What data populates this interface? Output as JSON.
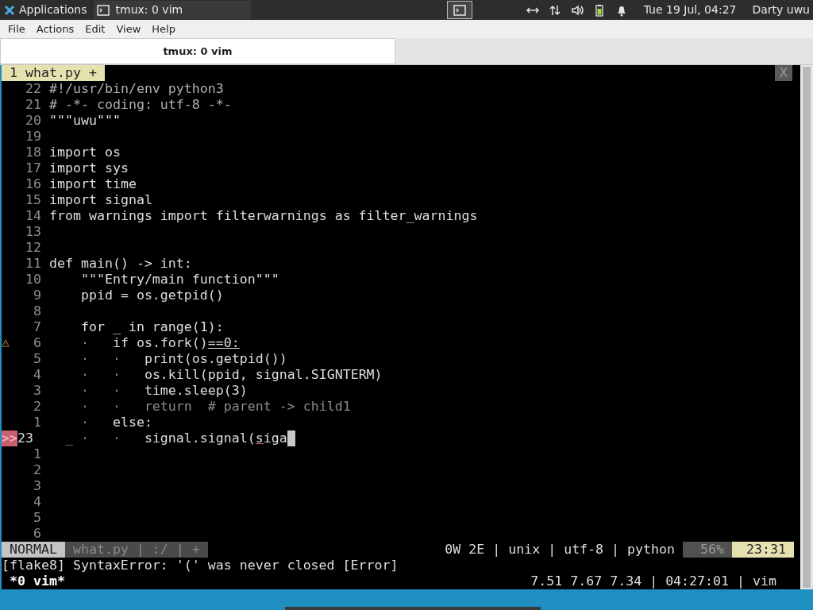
{
  "top_panel": {
    "applications": "Applications",
    "task": "tmux: 0 vim",
    "clock": "Tue 19 Jul, 04:27",
    "user": "Darty uwu"
  },
  "menu": [
    "File",
    "Actions",
    "Edit",
    "View",
    "Help"
  ],
  "window_tabs": [
    {
      "label": "tmux: 0 vim",
      "selected": true
    }
  ],
  "vim_tabs": [
    {
      "label": "1 what.py +",
      "selected": true
    }
  ],
  "vim_close": "X",
  "lines": [
    {
      "number": "22",
      "segments": [
        {
          "text": "#!/usr/bin/env python3",
          "kind": "comment"
        }
      ]
    },
    {
      "number": "21",
      "segments": [
        {
          "text": "# -*- coding: utf-8 -*-",
          "kind": "comment"
        }
      ]
    },
    {
      "number": "20",
      "segments": [
        {
          "text": "\"\"\"uwu\"\"\"",
          "kind": "plain"
        }
      ]
    },
    {
      "number": "19"
    },
    {
      "number": "18",
      "segments": [
        {
          "text": "import os",
          "kind": "plain"
        }
      ]
    },
    {
      "number": "17",
      "segments": [
        {
          "text": "import sys",
          "kind": "plain"
        }
      ]
    },
    {
      "number": "16",
      "segments": [
        {
          "text": "import time",
          "kind": "plain"
        }
      ]
    },
    {
      "number": "15",
      "segments": [
        {
          "text": "import signal",
          "kind": "plain"
        }
      ]
    },
    {
      "number": "14",
      "segments": [
        {
          "text": "from warnings import filterwarnings as filter_warnings",
          "kind": "plain"
        }
      ]
    },
    {
      "number": "13"
    },
    {
      "number": "12"
    },
    {
      "number": "11",
      "segments": [
        {
          "text": "def main() -> int:",
          "kind": "plain"
        }
      ]
    },
    {
      "number": "10",
      "segments": [
        {
          "text": "    \"\"\"Entry/main function\"\"\"",
          "kind": "plain"
        }
      ]
    },
    {
      "number": "9",
      "segments": [
        {
          "text": "    ppid = os.getpid()",
          "kind": "plain"
        }
      ]
    },
    {
      "number": "8"
    },
    {
      "number": "7",
      "segments": [
        {
          "text": "    for _ in range(1):",
          "kind": "plain"
        }
      ]
    },
    {
      "number": "6",
      "sign": {
        "kind": "warning"
      },
      "segments": [
        {
          "text": "    ·   ",
          "kind": "dim"
        },
        {
          "text": "if os.fork()",
          "kind": "plain"
        },
        {
          "text": "==0:",
          "kind": "underline"
        }
      ]
    },
    {
      "number": "5",
      "segments": [
        {
          "text": "    ·   ·   ",
          "kind": "dim"
        },
        {
          "text": "print(os.getpid())",
          "kind": "plain"
        }
      ]
    },
    {
      "number": "4",
      "segments": [
        {
          "text": "    ·   ·   ",
          "kind": "dim"
        },
        {
          "text": "os.kill(ppid, signal.SIGNTERM)",
          "kind": "plain"
        }
      ]
    },
    {
      "number": "3",
      "segments": [
        {
          "text": "    ·   ·   ",
          "kind": "dim"
        },
        {
          "text": "time.sleep(3)",
          "kind": "plain"
        }
      ]
    },
    {
      "number": "2",
      "segments": [
        {
          "text": "    ·   ·   return  # parent -> child1",
          "kind": "dim"
        }
      ]
    },
    {
      "number": "1",
      "segments": [
        {
          "text": "    ·   ",
          "kind": "dim"
        },
        {
          "text": "else:",
          "kind": "plain"
        }
      ]
    },
    {
      "number": "23",
      "current": true,
      "sign": {
        "kind": "marker",
        "text": ">>"
      },
      "segments": [
        {
          "text": "  _ ·   ·   ",
          "kind": "dim"
        },
        {
          "text": "signal.signal(",
          "kind": "plain"
        },
        {
          "text": "s",
          "kind": "error"
        },
        {
          "text": "iga",
          "kind": "plain"
        }
      ]
    },
    {
      "number": "1"
    },
    {
      "number": "2"
    },
    {
      "number": "3"
    },
    {
      "number": "4"
    },
    {
      "number": "5"
    },
    {
      "number": "6"
    }
  ],
  "statusline": {
    "mode": "NORMAL",
    "file": "what.py | :/ | +",
    "info": "0W 2E | unix | utf-8 | python",
    "percent": "56%",
    "position": "23:31"
  },
  "message": "[flake8] SyntaxError: '(' was never closed [Error]",
  "tmux": {
    "window": "*0 vim*",
    "right": "7.51 7.67 7.34 | 04:27:01 | vim"
  }
}
